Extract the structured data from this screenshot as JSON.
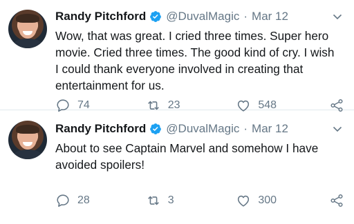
{
  "tweets": [
    {
      "author": {
        "name": "Randy Pitchford",
        "handle": "@DuvalMagic",
        "verified": true
      },
      "separator": "·",
      "date": "Mar 12",
      "text": "Wow, that was great. I cried three times. Super hero movie. Cried three times. The good kind of cry. I wish I could thank everyone involved in creating that entertainment for us.",
      "stats": {
        "replies": "74",
        "retweets": "23",
        "likes": "548"
      }
    },
    {
      "author": {
        "name": "Randy Pitchford",
        "handle": "@DuvalMagic",
        "verified": true
      },
      "separator": "·",
      "date": "Mar 12",
      "text": "About to see Captain Marvel and somehow I have avoided spoilers!",
      "stats": {
        "replies": "28",
        "retweets": "3",
        "likes": "300"
      }
    }
  ],
  "icons": [
    "verified-icon",
    "chevron-down-icon",
    "reply-icon",
    "retweet-icon",
    "like-icon",
    "share-icon"
  ],
  "colors": {
    "text": "#14171a",
    "secondary": "#657786",
    "verified": "#1da1f2",
    "divider": "#e1e8ed"
  }
}
